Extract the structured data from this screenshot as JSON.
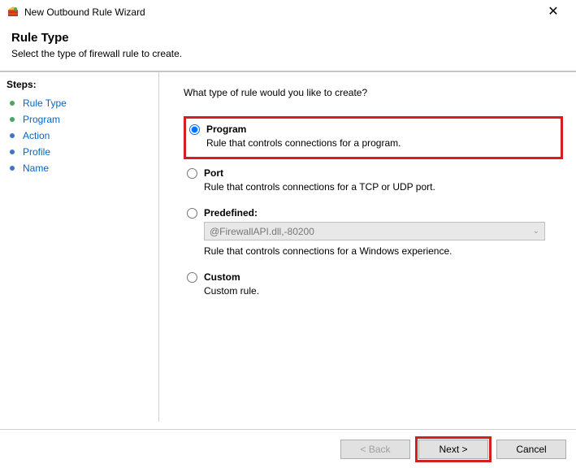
{
  "window": {
    "title": "New Outbound Rule Wizard"
  },
  "header": {
    "title": "Rule Type",
    "subtitle": "Select the type of firewall rule to create."
  },
  "sidebar": {
    "heading": "Steps:",
    "items": [
      {
        "label": "Rule Type"
      },
      {
        "label": "Program"
      },
      {
        "label": "Action"
      },
      {
        "label": "Profile"
      },
      {
        "label": "Name"
      }
    ]
  },
  "main": {
    "question": "What type of rule would you like to create?",
    "options": {
      "program": {
        "title": "Program",
        "desc": "Rule that controls connections for a program."
      },
      "port": {
        "title": "Port",
        "desc": "Rule that controls connections for a TCP or UDP port."
      },
      "predefined": {
        "title": "Predefined:",
        "select_value": "@FirewallAPI.dll,-80200",
        "desc": "Rule that controls connections for a Windows experience."
      },
      "custom": {
        "title": "Custom",
        "desc": "Custom rule."
      }
    }
  },
  "footer": {
    "back": "< Back",
    "next": "Next >",
    "cancel": "Cancel"
  }
}
